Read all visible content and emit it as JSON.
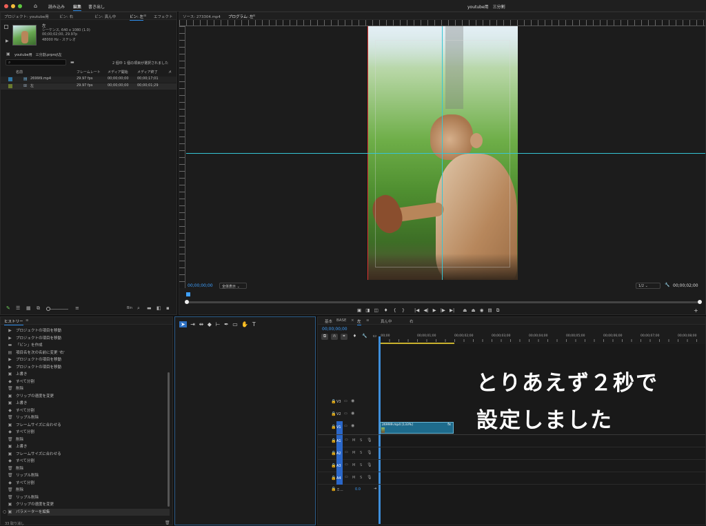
{
  "topbar": {
    "home_icon": "home-icon",
    "menu": [
      "読み込み",
      "編集",
      "書き出し"
    ],
    "active_menu": "編集",
    "title": "youtube用　三分割"
  },
  "project_panel": {
    "tabs": [
      "プロジェクト: youtube用",
      "ビン: 右",
      "ビン: 真ん中",
      "ビン: 左",
      "エフェクト"
    ],
    "active_tab": "ビン: 左",
    "preview": {
      "name": "左",
      "line1": "シーケンス, 640 x 1080 (1.0)",
      "line2": "00;00;02;00, 29.97p",
      "line3": "48000 Hz - ステレオ"
    },
    "breadcrumb": "youtube用　三分割.prproj\\左",
    "selection_status": "2 個中 1 個の項目が選択されました",
    "columns": [
      "名前",
      "フレームレート",
      "メディア開始",
      "メディア終了",
      "メ"
    ],
    "rows": [
      {
        "name": "2699l9.mp4",
        "fps": "29.97 fps",
        "start": "00;00;00;00",
        "end": "00;00;17;01"
      },
      {
        "name": "左",
        "fps": "29.97 fps",
        "start": "00;00;00;00",
        "end": "00;00;01;29"
      }
    ]
  },
  "monitor": {
    "tabs": [
      "ソース: 273304.mp4",
      "プログラム: 左"
    ],
    "active_tab": "プログラム: 左",
    "timecode_left": "00;00;00;00",
    "zoom": "全体表示",
    "quality": "1/2",
    "timecode_right": "00;00;02;00"
  },
  "history_panel": {
    "title": "ヒストリー",
    "items": [
      {
        "icon": "arrow",
        "label": "プロジェクトの項目を移動"
      },
      {
        "icon": "arrow",
        "label": "プロジェクトの項目を移動"
      },
      {
        "icon": "folder",
        "label": "「ビン」を作成"
      },
      {
        "icon": "doc",
        "label": "項目名を次の名前に変更 '右'"
      },
      {
        "icon": "arrow",
        "label": "プロジェクトの項目を移動"
      },
      {
        "icon": "arrow",
        "label": "プロジェクトの項目を移動"
      },
      {
        "icon": "box",
        "label": "上書き"
      },
      {
        "icon": "tag",
        "label": "すべて分割"
      },
      {
        "icon": "trash",
        "label": "削除"
      },
      {
        "icon": "box",
        "label": "クリップの速度を変更"
      },
      {
        "icon": "box",
        "label": "上書き"
      },
      {
        "icon": "tag",
        "label": "すべて分割"
      },
      {
        "icon": "trash",
        "label": "リップル削除"
      },
      {
        "icon": "box",
        "label": "フレームサイズに合わせる"
      },
      {
        "icon": "tag",
        "label": "すべて分割"
      },
      {
        "icon": "trash",
        "label": "削除"
      },
      {
        "icon": "box",
        "label": "上書き"
      },
      {
        "icon": "box",
        "label": "フレームサイズに合わせる"
      },
      {
        "icon": "tag",
        "label": "すべて分割"
      },
      {
        "icon": "trash",
        "label": "削除"
      },
      {
        "icon": "trash",
        "label": "リップル削除"
      },
      {
        "icon": "tag",
        "label": "すべて分割"
      },
      {
        "icon": "trash",
        "label": "削除"
      },
      {
        "icon": "trash",
        "label": "リップル削除"
      },
      {
        "icon": "box",
        "label": "クリップの速度を変更"
      },
      {
        "icon": "box",
        "label": "パラメーターを編集"
      }
    ],
    "footer": "33 取り消し"
  },
  "timeline": {
    "tabs": [
      "基本",
      "BASE",
      "左",
      "真ん中",
      "右"
    ],
    "active_tab": "左",
    "timecode": "00;00;00;00",
    "ruler": [
      ":00;00",
      "00;00;01;00",
      "00;00;02;00",
      "00;00;03;00",
      "00;00;04;00",
      "00;00;05;00",
      "00;00;06;00",
      "00;00;07;00",
      "00;00;08;00"
    ],
    "video_tracks": [
      "V3",
      "V2",
      "V1"
    ],
    "audio_tracks": [
      "A1",
      "A2",
      "A3",
      "A4"
    ],
    "master_label": "ミ...",
    "master_value": "0.0",
    "clip_label": "2699l9.mp4 [133%]"
  },
  "overlay": {
    "line1": "とりあえず２秒で",
    "line2": "設定しました"
  },
  "colors": {
    "accent": "#2d8ceb",
    "clip": "#1e6b8c",
    "guide": "#35c6d6",
    "track_active": "#2a67c9"
  }
}
